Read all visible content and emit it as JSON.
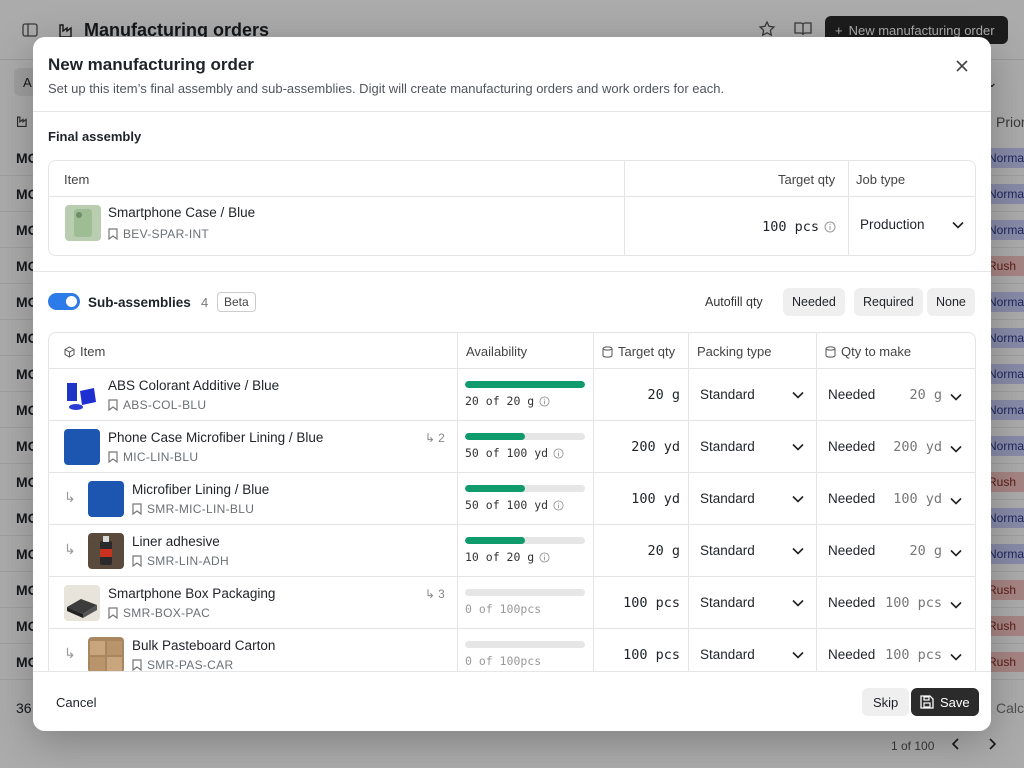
{
  "background": {
    "title": "Manufacturing orders",
    "new_button": "New manufacturing order",
    "filter_label": "A",
    "priority_header": "Prior",
    "rows": [
      {
        "mo": "MO",
        "priority": "Norma",
        "kind": "normal"
      },
      {
        "mo": "MO",
        "priority": "Norma",
        "kind": "normal"
      },
      {
        "mo": "MO",
        "priority": "Norma",
        "kind": "normal"
      },
      {
        "mo": "MO",
        "priority": "Rush",
        "kind": "rush"
      },
      {
        "mo": "MO",
        "priority": "Norma",
        "kind": "normal"
      },
      {
        "mo": "MO",
        "priority": "Norma",
        "kind": "normal"
      },
      {
        "mo": "MO",
        "priority": "Norma",
        "kind": "normal"
      },
      {
        "mo": "MO",
        "priority": "Norma",
        "kind": "normal"
      },
      {
        "mo": "MO",
        "priority": "Norma",
        "kind": "normal"
      },
      {
        "mo": "MO",
        "priority": "Rush",
        "kind": "rush"
      },
      {
        "mo": "MO",
        "priority": "Norma",
        "kind": "normal"
      },
      {
        "mo": "MO",
        "priority": "Norma",
        "kind": "normal"
      },
      {
        "mo": "MO",
        "priority": "Rush",
        "kind": "rush"
      },
      {
        "mo": "MO",
        "priority": "Rush",
        "kind": "rush"
      },
      {
        "mo": "MO",
        "priority": "Rush",
        "kind": "rush"
      }
    ],
    "footer_count": "36",
    "calc": "Calc",
    "pager": "1 of 100"
  },
  "modal": {
    "title": "New manufacturing order",
    "subtitle": "Set up this item’s final assembly and sub-assemblies. Digit will create manufacturing orders and work orders for each.",
    "final_assembly": {
      "label": "Final assembly",
      "headers": {
        "item": "Item",
        "target_qty": "Target qty",
        "job_type": "Job type"
      },
      "item": {
        "name": "Smartphone Case / Blue",
        "sku": "BEV-SPAR-INT"
      },
      "target_qty": "100 pcs",
      "job_type": "Production"
    },
    "sub_assemblies": {
      "label": "Sub-assemblies",
      "count": "4",
      "beta": "Beta",
      "autofill_label": "Autofill qty",
      "autofill_options": [
        "Needed",
        "Required",
        "None"
      ],
      "headers": {
        "item": "Item",
        "availability": "Availability",
        "target_qty": "Target qty",
        "packing_type": "Packing type",
        "qty_to_make": "Qty to make"
      },
      "rows": [
        {
          "name": "ABS Colorant Additive / Blue",
          "sku": "ABS-COL-BLU",
          "indent": false,
          "subcount": "",
          "avail_fraction": 1.0,
          "avail_text": "20 of 20 g",
          "target": "20 g",
          "packing": "Standard",
          "need": "Needed",
          "need_qty": "20 g",
          "thumb": "colorant"
        },
        {
          "name": "Phone Case Microfiber Lining / Blue",
          "sku": "MIC-LIN-BLU",
          "indent": false,
          "subcount": "2",
          "avail_fraction": 0.5,
          "avail_text": "50 of 100 yd",
          "target": "200 yd",
          "packing": "Standard",
          "need": "Needed",
          "need_qty": "200 yd",
          "thumb": "blue"
        },
        {
          "name": "Microfiber Lining / Blue",
          "sku": "SMR-MIC-LIN-BLU",
          "indent": true,
          "subcount": "",
          "avail_fraction": 0.5,
          "avail_text": "50 of 100 yd",
          "target": "100 yd",
          "packing": "Standard",
          "need": "Needed",
          "need_qty": "100 yd",
          "thumb": "blue"
        },
        {
          "name": "Liner adhesive",
          "sku": "SMR-LIN-ADH",
          "indent": true,
          "subcount": "",
          "avail_fraction": 0.5,
          "avail_text": "10 of 20 g",
          "target": "20 g",
          "packing": "Standard",
          "need": "Needed",
          "need_qty": "20 g",
          "thumb": "adhesive"
        },
        {
          "name": "Smartphone Box Packaging",
          "sku": "SMR-BOX-PAC",
          "indent": false,
          "subcount": "3",
          "avail_fraction": 0,
          "avail_text": "0 of 100pcs",
          "target": "100 pcs",
          "packing": "Standard",
          "need": "Needed",
          "need_qty": "100 pcs",
          "thumb": "box"
        },
        {
          "name": "Bulk Pasteboard Carton",
          "sku": "SMR-PAS-CAR",
          "indent": true,
          "subcount": "",
          "avail_fraction": 0,
          "avail_text": "0 of 100pcs",
          "target": "100 pcs",
          "packing": "Standard",
          "need": "Needed",
          "need_qty": "100 pcs",
          "thumb": "carton"
        }
      ]
    },
    "footer": {
      "cancel": "Cancel",
      "skip": "Skip",
      "save": "Save"
    }
  }
}
